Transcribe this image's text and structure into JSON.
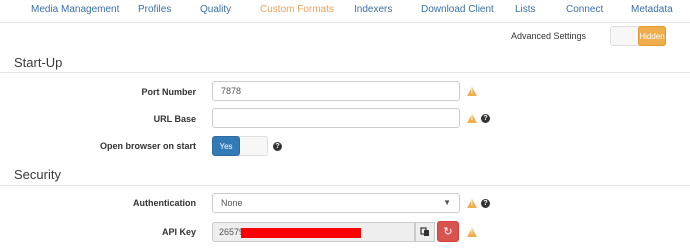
{
  "tabs": [
    {
      "label": "Media Management"
    },
    {
      "label": "Profiles"
    },
    {
      "label": "Quality"
    },
    {
      "label": "Custom Formats",
      "active": true
    },
    {
      "label": "Indexers"
    },
    {
      "label": "Download Client"
    },
    {
      "label": "Lists"
    },
    {
      "label": "Connect"
    },
    {
      "label": "Metadata"
    }
  ],
  "advanced": {
    "label": "Advanced Settings",
    "state": "Hidden"
  },
  "startup": {
    "title": "Start-Up",
    "port": {
      "label": "Port Number",
      "value": "7878"
    },
    "url_base": {
      "label": "URL Base",
      "value": ""
    },
    "open_browser": {
      "label": "Open browser on start",
      "state": "Yes"
    }
  },
  "security": {
    "title": "Security",
    "authentication": {
      "label": "Authentication",
      "value": "None"
    },
    "api_key": {
      "label": "API Key",
      "visible_prefix": "26579"
    }
  },
  "colors": {
    "link": "#3a6fa6",
    "active_tab": "#f0a05a",
    "warning": "#f0ad4e",
    "primary": "#337ab7",
    "danger": "#d9534f",
    "redaction": "#ff0000"
  },
  "icons": [
    "warning-icon",
    "help-icon",
    "copy-icon",
    "refresh-icon",
    "caret-down-icon"
  ]
}
